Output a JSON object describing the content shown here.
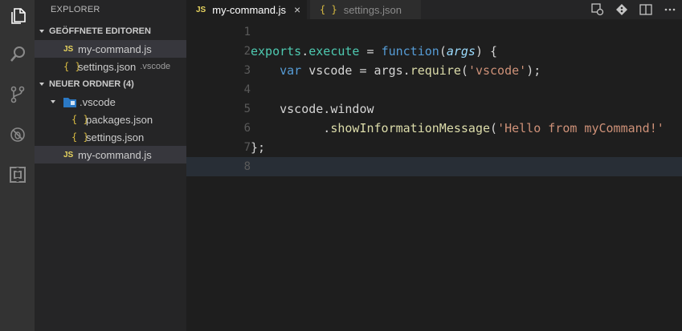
{
  "explorer": {
    "title": "EXPLORER",
    "open_editors": {
      "header": "GEÖFFNETE EDITOREN",
      "items": [
        {
          "badge": "JS",
          "name": "my-command.js",
          "desc": ""
        },
        {
          "badge": "{ }",
          "name": "settings.json",
          "desc": ".vscode"
        }
      ]
    },
    "folder": {
      "header": "NEUER ORDNER (4)",
      "items": [
        {
          "badge": "",
          "name": ".vscode"
        },
        {
          "badge": "{ }",
          "name": "packages.json"
        },
        {
          "badge": "{ }",
          "name": "settings.json"
        },
        {
          "badge": "JS",
          "name": "my-command.js"
        }
      ]
    }
  },
  "tabs": [
    {
      "badge": "JS",
      "label": "my-command.js",
      "close": "×"
    },
    {
      "badge": "{ }",
      "label": "settings.json"
    }
  ],
  "line_numbers": [
    "1",
    "2",
    "3",
    "4",
    "5",
    "6",
    "7",
    "8"
  ],
  "code": {
    "l2": {
      "a": "exports",
      "b": ".",
      "c": "execute",
      "d": " = ",
      "e": "function",
      "f": "(",
      "g": "args",
      "h": ") {"
    },
    "l3": {
      "a": "    ",
      "b": "var",
      "c": " vscode ",
      "d": "=",
      "e": " args.",
      "f": "require",
      "g": "(",
      "h": "'vscode'",
      "i": ");"
    },
    "l5": {
      "a": "    vscode.window"
    },
    "l6": {
      "a": "          .",
      "b": "showInformationMessage",
      "c": "(",
      "d": "'Hello from myCommand!'"
    },
    "l7": {
      "a": "};"
    }
  },
  "colors": {
    "activity_bar": "#333333",
    "sidebar": "#252526",
    "editor": "#1e1e1e",
    "keyword": "#569cd6",
    "function": "#dcdcaa",
    "string": "#ce9178"
  },
  "icons": {
    "activity": [
      "files-icon",
      "search-icon",
      "source-control-icon",
      "debug-icon",
      "extensions-icon"
    ],
    "editor_actions": [
      "open-changes-icon",
      "git-icon",
      "split-editor-icon",
      "more-icon"
    ]
  }
}
